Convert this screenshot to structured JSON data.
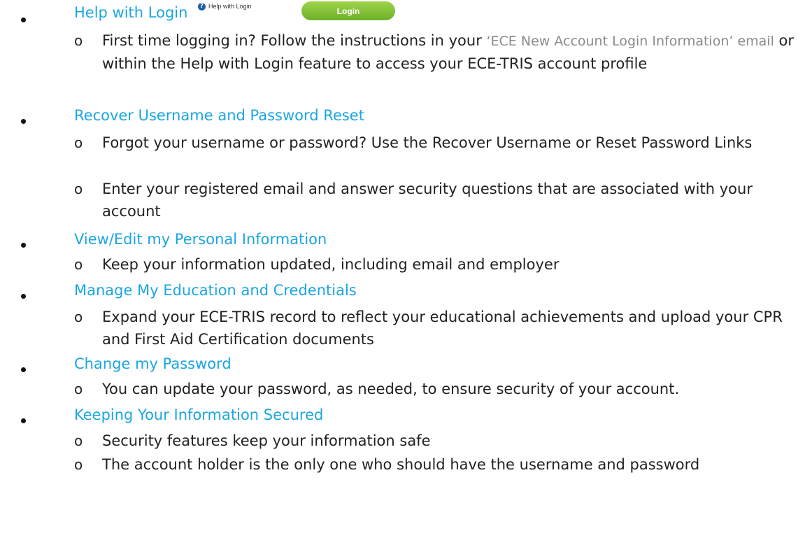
{
  "top_widgets": {
    "help_link_label": "Help with Login",
    "help_icon_glyph": "?",
    "login_button_label": "Login",
    "login_button_color": "#7cc236"
  },
  "colors": {
    "heading": "#1aa6e0",
    "body_text": "#222222",
    "muted_quote": "#8a8a8a"
  },
  "sections": [
    {
      "heading": "Help with Login",
      "items": [
        {
          "before": "First time logging in? Follow the instructions in your ",
          "quoted": "‘ECE New Account Login Information’ email",
          "after": " or within the Help with Login feature to access your ECE-TRIS account profile"
        }
      ]
    },
    {
      "heading": "Recover Username and Password Reset",
      "items": [
        {
          "text": "Forgot your username or password?  Use the Recover Username or Reset Password Links"
        },
        {
          "text": "Enter your registered email and answer security questions that are associated with your account"
        }
      ]
    },
    {
      "heading": "View/Edit my Personal Information",
      "items": [
        {
          "text": "Keep your information updated, including email and employer"
        }
      ]
    },
    {
      "heading": "Manage My Education and Credentials",
      "items": [
        {
          "text": "Expand your ECE-TRIS record to reflect your educational achievements and upload your CPR and First Aid Certification documents"
        }
      ]
    },
    {
      "heading": "Change my Password",
      "items": [
        {
          "text": "You can update your password, as needed, to ensure security of your account."
        }
      ]
    },
    {
      "heading": "Keeping Your Information Secured",
      "items": [
        {
          "text": "Security features keep your information safe"
        },
        {
          "text": "The account holder is the only one who should have the username and password"
        }
      ]
    }
  ],
  "sub_marker": "o"
}
